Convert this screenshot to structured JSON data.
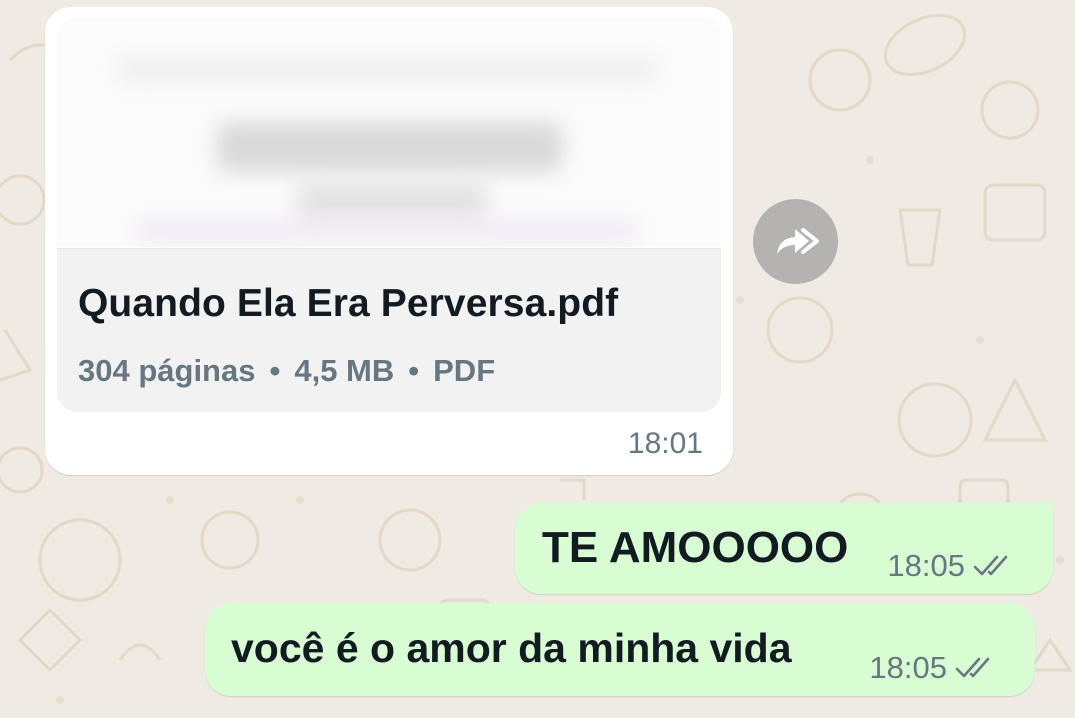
{
  "chat": {
    "document_message": {
      "file_name": "Quando Ela Era Perversa.pdf",
      "pages": "304 páginas",
      "separator": "•",
      "size": "4,5 MB",
      "type": "PDF",
      "time": "18:01"
    },
    "forward_icon": "forward-icon",
    "outgoing_messages": [
      {
        "text": "TE AMOOOOO",
        "time": "18:05",
        "status_icon": "double-check-icon"
      },
      {
        "text": "você é o amor da minha vida",
        "time": "18:05",
        "status_icon": "double-check-icon"
      }
    ]
  },
  "colors": {
    "background": "#efeae2",
    "incoming_bubble": "#ffffff",
    "outgoing_bubble": "#d9fdd3",
    "meta_text": "#667781",
    "primary_text": "#111b21"
  }
}
